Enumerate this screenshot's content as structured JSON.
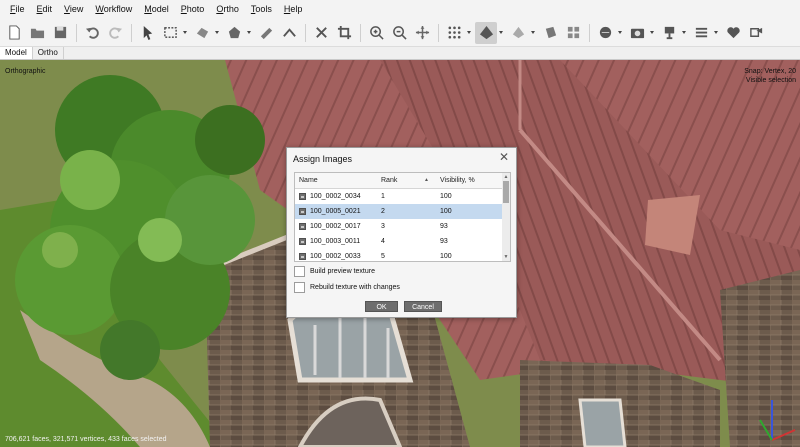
{
  "menu": [
    "File",
    "Edit",
    "View",
    "Workflow",
    "Model",
    "Photo",
    "Ortho",
    "Tools",
    "Help"
  ],
  "tabs": [
    "Model",
    "Ortho"
  ],
  "viewport": {
    "projection": "Orthographic",
    "snap": "Snap: Vertex, 20",
    "selection_mode": "Visible selection",
    "status": "706,621 faces, 321,571 vertices, 433 faces selected"
  },
  "dialog": {
    "title": "Assign Images",
    "close_glyph": "✕",
    "columns": {
      "name": "Name",
      "rank": "Rank",
      "visibility": "Visibility, %"
    },
    "rows": [
      {
        "name": "100_0002_0034",
        "rank": "1",
        "visibility": "100",
        "selected": false
      },
      {
        "name": "100_0005_0021",
        "rank": "2",
        "visibility": "100",
        "selected": true
      },
      {
        "name": "100_0002_0017",
        "rank": "3",
        "visibility": "93",
        "selected": false
      },
      {
        "name": "100_0003_0011",
        "rank": "4",
        "visibility": "93",
        "selected": false
      },
      {
        "name": "100_0002_0033",
        "rank": "5",
        "visibility": "100",
        "selected": false
      }
    ],
    "build_preview_label": "Build preview texture",
    "build_preview_checked": false,
    "rebuild_texture_label": "Rebuild texture with changes",
    "rebuild_texture_checked": false,
    "ok_label": "OK",
    "cancel_label": "Cancel"
  },
  "colors": {
    "roof": "#9c5d5b",
    "stone": "#6e5c4e",
    "tree": "#4f8a2c",
    "selected_row": "#c4d9ef",
    "button": "#6d6d6d"
  },
  "icons": [
    "new-icon",
    "open-icon",
    "save-icon",
    "undo-icon",
    "redo-icon",
    "navigation-icon",
    "rectangle-selection-icon",
    "free-form-selection-icon",
    "polygon-icon",
    "ruler-icon",
    "shape-icon",
    "delete-icon",
    "crop-icon",
    "zoom-in-icon",
    "zoom-out-icon",
    "move-icon",
    "points-icon",
    "solid-model-icon",
    "shaded-model-icon",
    "textured-model-icon",
    "tiled-model-icon",
    "dem-icon",
    "camera-icon",
    "show-cameras-icon",
    "menu-icon",
    "shapes-icon",
    "share-icon"
  ]
}
